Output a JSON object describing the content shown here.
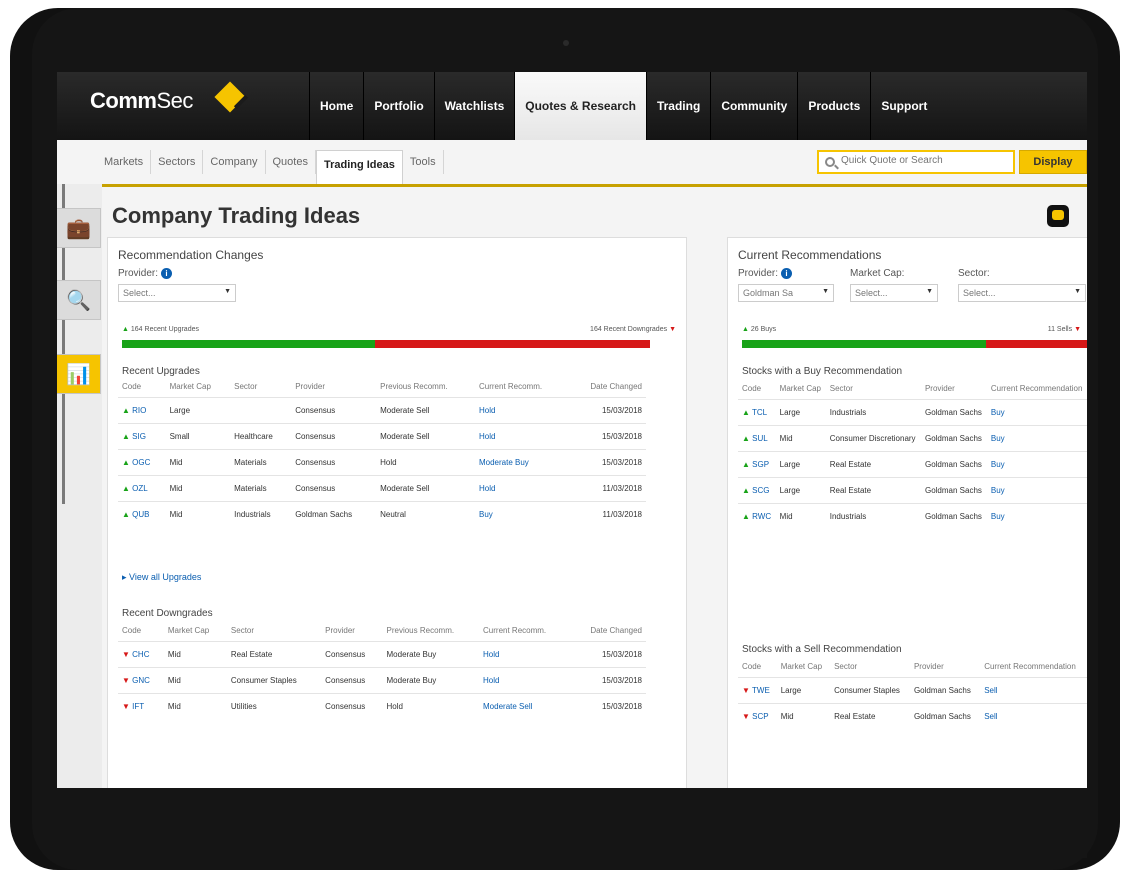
{
  "app": {
    "brand_main": "Comm",
    "brand_sub": "Sec"
  },
  "topnav": [
    "Home",
    "Portfolio",
    "Watchlists",
    "Quotes & Research",
    "Trading",
    "Community",
    "Products",
    "Support"
  ],
  "topnav_active": 3,
  "subnav": [
    "Markets",
    "Sectors",
    "Company",
    "Quotes",
    "Trading Ideas",
    "Tools"
  ],
  "subnav_active": 4,
  "search": {
    "placeholder": "Quick Quote or Search",
    "button": "Display"
  },
  "page": {
    "title": "Company Trading Ideas"
  },
  "left": {
    "title": "Recommendation Changes",
    "provider_label": "Provider:",
    "provider_value": "Select...",
    "upgrades_count": "164 Recent Upgrades",
    "downgrades_count": "164 Recent Downgrades",
    "upgrades_share": 0.48,
    "upgrades_title": "Recent Upgrades",
    "headers": [
      "Code",
      "Market Cap",
      "Sector",
      "Provider",
      "Previous Recomm.",
      "Current Recomm.",
      "Date Changed"
    ],
    "upgrades": [
      [
        "RIO",
        "Large",
        "",
        "Consensus",
        "Moderate Sell",
        "Hold",
        "15/03/2018"
      ],
      [
        "SIG",
        "Small",
        "Healthcare",
        "Consensus",
        "Moderate Sell",
        "Hold",
        "15/03/2018"
      ],
      [
        "OGC",
        "Mid",
        "Materials",
        "Consensus",
        "Hold",
        "Moderate Buy",
        "15/03/2018"
      ],
      [
        "OZL",
        "Mid",
        "Materials",
        "Consensus",
        "Moderate Sell",
        "Hold",
        "11/03/2018"
      ],
      [
        "QUB",
        "Mid",
        "Industrials",
        "Goldman Sachs",
        "Neutral",
        "Buy",
        "11/03/2018"
      ]
    ],
    "view_all": "View all Upgrades",
    "downgrades_title": "Recent Downgrades",
    "downgrades": [
      [
        "CHC",
        "Mid",
        "Real Estate",
        "Consensus",
        "Moderate Buy",
        "Hold",
        "15/03/2018"
      ],
      [
        "GNC",
        "Mid",
        "Consumer Staples",
        "Consensus",
        "Moderate Buy",
        "Hold",
        "15/03/2018"
      ],
      [
        "IFT",
        "Mid",
        "Utilities",
        "Consensus",
        "Hold",
        "Moderate Sell",
        "15/03/2018"
      ]
    ]
  },
  "right": {
    "title": "Current Recommendations",
    "provider_label": "Provider:",
    "provider_value": "Goldman Sa",
    "mcap_label": "Market Cap:",
    "mcap_value": "Select...",
    "sector_label": "Sector:",
    "sector_value": "Select...",
    "buys": "26 Buys",
    "sells": "11 Sells",
    "buy_share": 0.7,
    "buy_title": "Stocks with a Buy Recommendation",
    "headers": [
      "Code",
      "Market Cap",
      "Sector",
      "Provider",
      "Current Recommendation"
    ],
    "buy_rows": [
      [
        "TCL",
        "Large",
        "Industrials",
        "Goldman Sachs",
        "Buy"
      ],
      [
        "SUL",
        "Mid",
        "Consumer Discretionary",
        "Goldman Sachs",
        "Buy"
      ],
      [
        "SGP",
        "Large",
        "Real Estate",
        "Goldman Sachs",
        "Buy"
      ],
      [
        "SCG",
        "Large",
        "Real Estate",
        "Goldman Sachs",
        "Buy"
      ],
      [
        "RWC",
        "Mid",
        "Industrials",
        "Goldman Sachs",
        "Buy"
      ]
    ],
    "sell_title": "Stocks with a Sell Recommendation",
    "sell_rows": [
      [
        "TWE",
        "Large",
        "Consumer Staples",
        "Goldman Sachs",
        "Sell"
      ],
      [
        "SCP",
        "Mid",
        "Real Estate",
        "Goldman Sachs",
        "Sell"
      ]
    ]
  }
}
